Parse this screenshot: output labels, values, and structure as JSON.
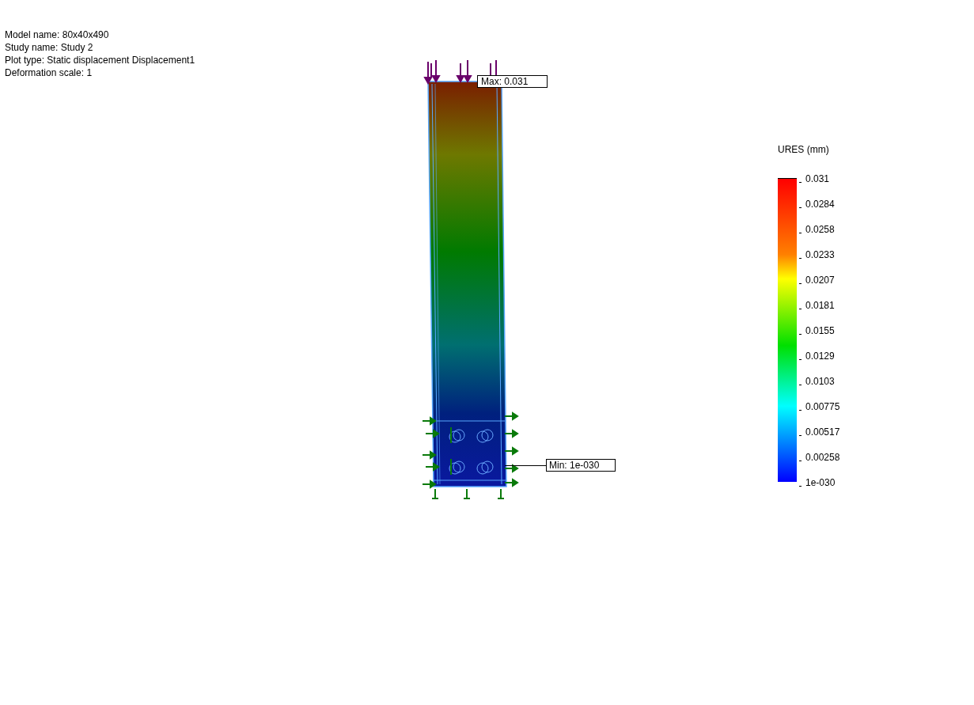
{
  "plot_info": [
    "Model name: 80x40x490",
    "Study name: Study 2",
    "Plot type: Static displacement Displacement1",
    "Deformation scale: 1"
  ],
  "max_label": "Max: 0.031",
  "min_label": "Min: 1e-030",
  "legend": {
    "title": "URES (mm)",
    "labels": [
      "0.031",
      "0.0284",
      "0.0258",
      "0.0233",
      "0.0207",
      "0.0181",
      "0.0155",
      "0.0129",
      "0.0103",
      "0.00775",
      "0.00517",
      "0.00258",
      "1e-030"
    ]
  }
}
